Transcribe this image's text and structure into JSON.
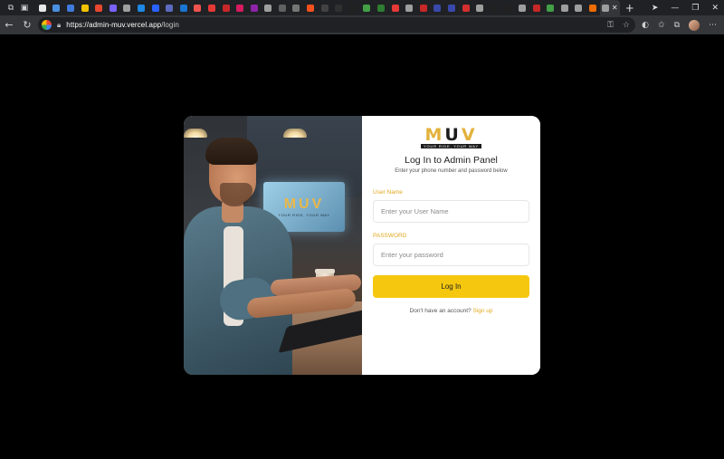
{
  "browser": {
    "tab_favicon_colors": [
      "#e8e8e8",
      "#4a90e2",
      "#3f7bdc",
      "#f2c200",
      "#e8462f",
      "#7b61ff",
      "#9e9e9e",
      "#1e88e5",
      "#2962ff",
      "#5c6bc0",
      "#1976d2",
      "#ef5350",
      "#e53935",
      "#c62828",
      "#d81b60",
      "#8e24aa",
      "#9e9e9e",
      "#616161",
      "#757575",
      "#f4511e",
      "#424242",
      "#303030",
      "#212121",
      "#43a047",
      "#2e7d32",
      "#e53935",
      "#9e9e9e",
      "#c62828",
      "#3949ab",
      "#3949ab",
      "#d32f2f",
      "#9e9e9e",
      "#212121",
      "#212121",
      "#9e9e9e",
      "#c62828",
      "#43a047",
      "#9e9e9e",
      "#9e9e9e",
      "#ef6c00",
      "#9e9e9e"
    ],
    "new_tab_icon": "+",
    "url_host": "https://admin-muv.vercel.app",
    "url_path": "/login"
  },
  "form": {
    "logo_letters": [
      "M",
      "U",
      "V"
    ],
    "logo_tagline": "YOUR RIDE, YOUR WAY",
    "title": "Log In to Admin Panel",
    "subtitle": "Enter your phone number and password below",
    "username_label": "User Name",
    "username_placeholder": "Enter your User Name",
    "password_label": "PASSWORD",
    "password_placeholder": "Enter your password",
    "login_button": "Log In",
    "signup_prompt": "Don't have an account?",
    "signup_link": "Sign up"
  },
  "photo": {
    "monitor_logo": "MUV",
    "monitor_tagline": "YOUR RIDE, YOUR WAY"
  },
  "colors": {
    "accent": "#f5c80f",
    "label": "#e0a91f",
    "page_bg": "#000000"
  }
}
